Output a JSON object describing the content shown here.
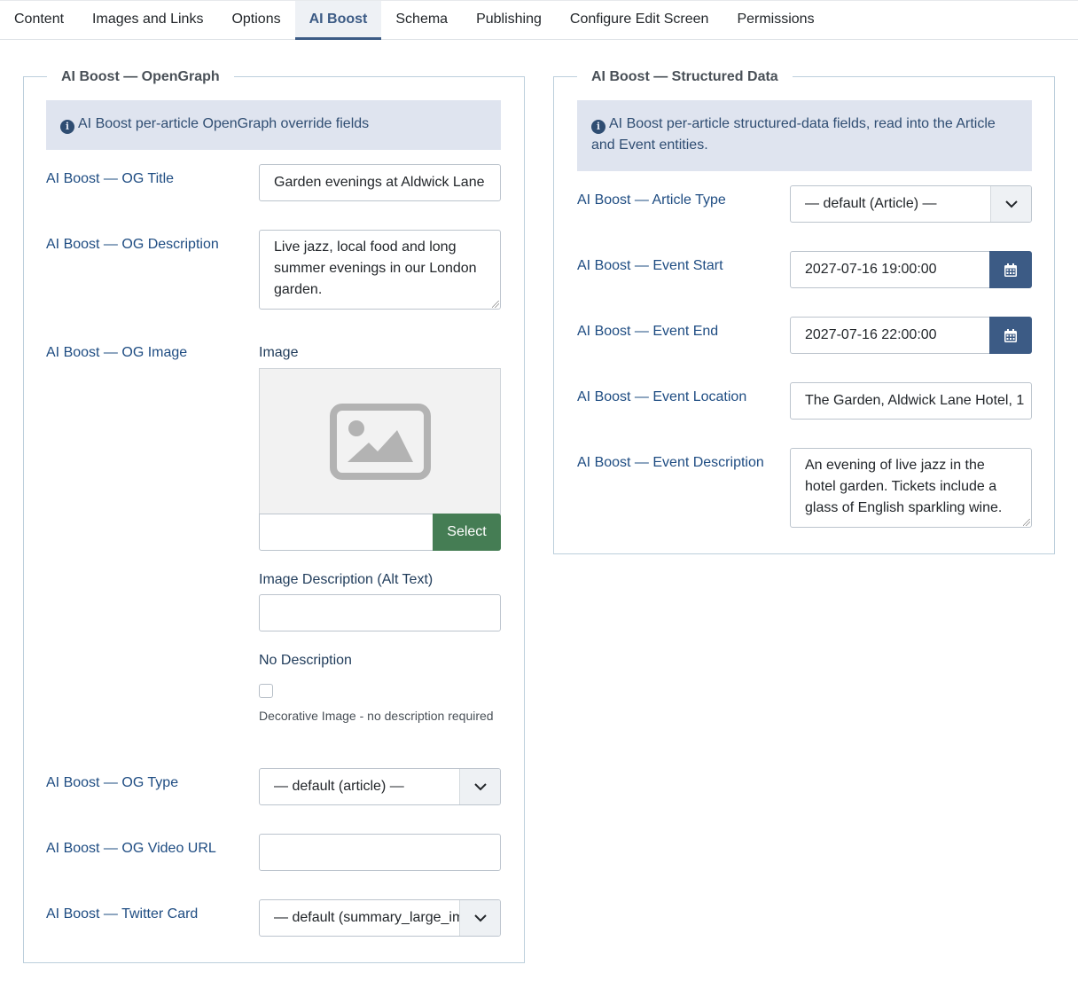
{
  "tabs": [
    "Content",
    "Images and Links",
    "Options",
    "AI Boost",
    "Schema",
    "Publishing",
    "Configure Edit Screen",
    "Permissions"
  ],
  "active_tab": "AI Boost",
  "opengraph": {
    "legend": "AI Boost — OpenGraph",
    "info": "AI Boost per-article OpenGraph override fields",
    "og_title_label": "AI Boost — OG Title",
    "og_title_value": "Garden evenings at Aldwick Lane",
    "og_description_label": "AI Boost — OG Description",
    "og_description_value": "Live jazz, local food and long summer evenings in our London garden.",
    "og_image_label": "AI Boost — OG Image",
    "image_label": "Image",
    "select_button": "Select",
    "alt_text_label": "Image Description (Alt Text)",
    "alt_text_value": "",
    "no_description_label": "No Description",
    "decorative_hint": "Decorative Image - no description required",
    "og_type_label": "AI Boost — OG Type",
    "og_type_value": "— default (article) —",
    "og_video_label": "AI Boost — OG Video URL",
    "og_video_value": "",
    "twitter_card_label": "AI Boost — Twitter Card",
    "twitter_card_value": "— default (summary_large_image) —"
  },
  "structured": {
    "legend": "AI Boost — Structured Data",
    "info": "AI Boost per-article structured-data fields, read into the Article and Event entities.",
    "article_type_label": "AI Boost — Article Type",
    "article_type_value": "— default (Article) —",
    "event_start_label": "AI Boost — Event Start",
    "event_start_value": "2027-07-16 19:00:00",
    "event_end_label": "AI Boost — Event End",
    "event_end_value": "2027-07-16 22:00:00",
    "event_location_label": "AI Boost — Event Location",
    "event_location_value": "The Garden, Aldwick Lane Hotel, 1",
    "event_description_label": "AI Boost — Event Description",
    "event_description_value": "An evening of live jazz in the hotel garden. Tickets include a glass of English sparkling wine."
  },
  "colors": {
    "active_tab": "#3c5b85",
    "label": "#1e4c82",
    "info_bg": "#dfe4ef",
    "select_button": "#457d54",
    "calendar_button": "#3c5b85"
  }
}
